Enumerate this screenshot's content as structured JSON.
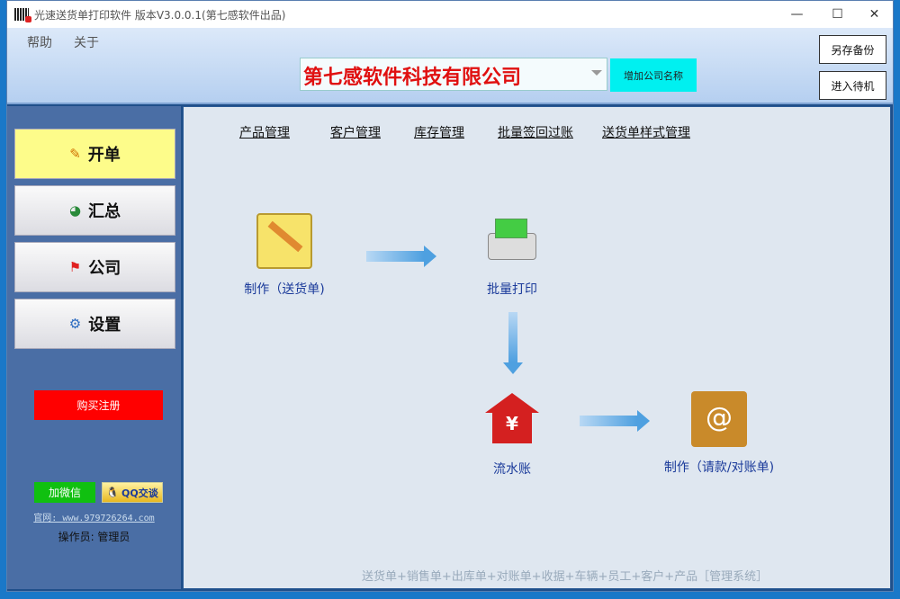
{
  "window": {
    "title": "光速送货单打印软件 版本V3.0.0.1(第七感软件出品)",
    "minimize": "—",
    "maximize": "☐",
    "close": "✕"
  },
  "menu": [
    "帮助",
    "关于"
  ],
  "company": {
    "name": "第七感软件科技有限公司",
    "add_label": "增加公司名称"
  },
  "right_buttons": {
    "backup": "另存备份",
    "standby": "进入待机"
  },
  "sidebar": {
    "items": [
      {
        "label": "开单",
        "icon": "✎"
      },
      {
        "label": "汇总",
        "icon": "◕"
      },
      {
        "label": "公司",
        "icon": "⚑"
      },
      {
        "label": "设置",
        "icon": "⚙"
      }
    ],
    "buy": "购买注册",
    "wechat": "加微信",
    "qq": "QQ交谈",
    "website": "官网: www.979726264.com",
    "operator": "操作员: 管理员"
  },
  "tabs": [
    "产品管理",
    "客户管理",
    "库存管理",
    "批量签回过账",
    "送货单样式管理"
  ],
  "flow": {
    "make_delivery": "制作（送货单)",
    "batch_print": "批量打印",
    "ledger": "流水账",
    "make_statement": "制作（请款/对账单)"
  },
  "footer": "送货单+销售单+出库单+对账单+收据+车辆+员工+客户+产品［管理系统］",
  "colors": {
    "accent": "#e01010",
    "buy": "#ff0000",
    "wechat": "#10c010",
    "add": "#00f0f0"
  }
}
